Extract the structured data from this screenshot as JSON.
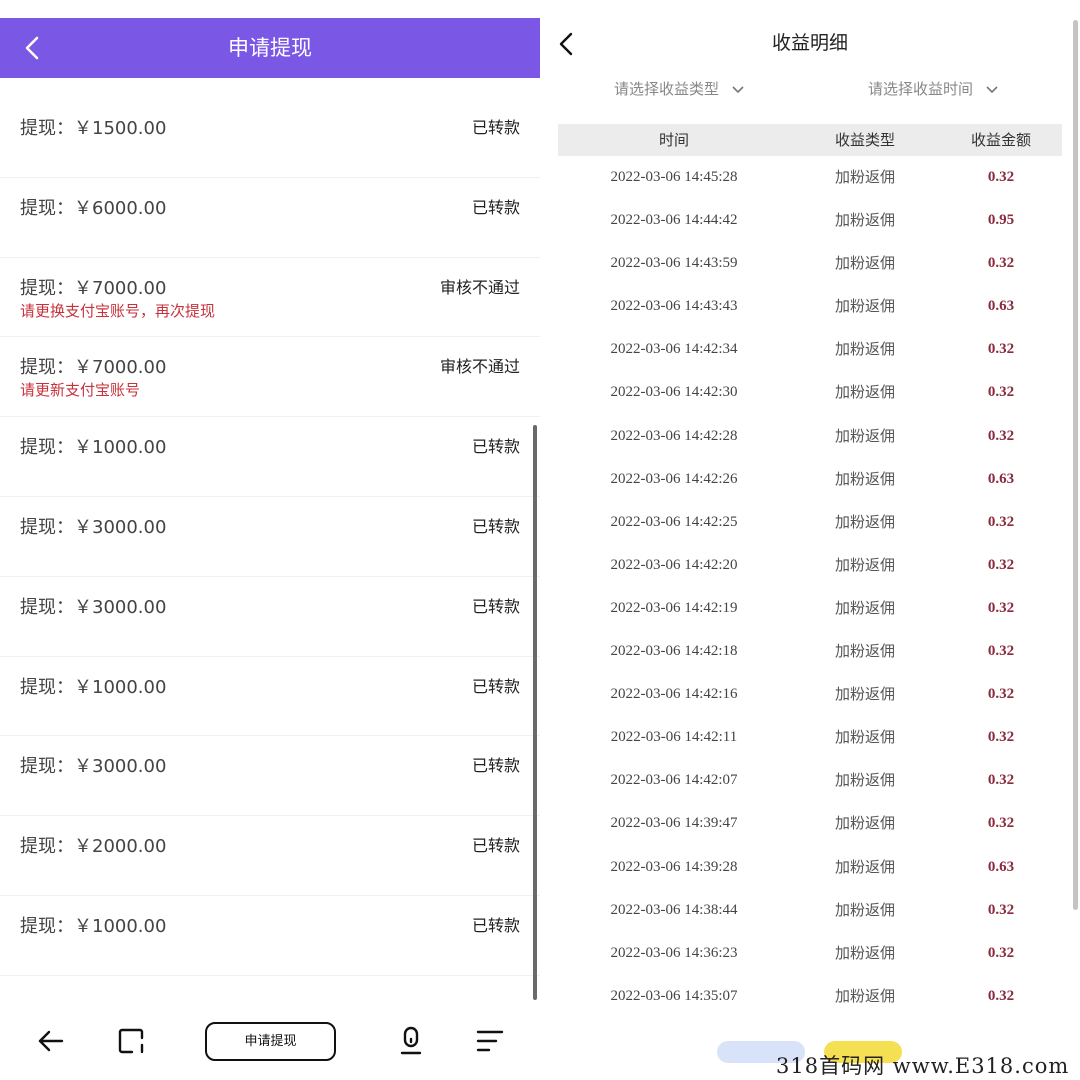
{
  "left": {
    "title": "申请提现",
    "items": [
      {
        "amount": "提现：￥1500.00",
        "status": "已转款",
        "note": ""
      },
      {
        "amount": "提现：￥6000.00",
        "status": "已转款",
        "note": ""
      },
      {
        "amount": "提现：￥7000.00",
        "status": "审核不通过",
        "note": "请更换支付宝账号，再次提现"
      },
      {
        "amount": "提现：￥7000.00",
        "status": "审核不通过",
        "note": "请更新支付宝账号"
      },
      {
        "amount": "提现：￥1000.00",
        "status": "已转款",
        "note": ""
      },
      {
        "amount": "提现：￥3000.00",
        "status": "已转款",
        "note": ""
      },
      {
        "amount": "提现：￥3000.00",
        "status": "已转款",
        "note": ""
      },
      {
        "amount": "提现：￥1000.00",
        "status": "已转款",
        "note": ""
      },
      {
        "amount": "提现：￥3000.00",
        "status": "已转款",
        "note": ""
      },
      {
        "amount": "提现：￥2000.00",
        "status": "已转款",
        "note": ""
      },
      {
        "amount": "提现：￥1000.00",
        "status": "已转款",
        "note": ""
      }
    ],
    "nav": {
      "back_icon": "arrow-left-icon",
      "recents_icon": "square-corner-icon",
      "button_label": "申请提现",
      "mic_icon": "microphone-icon",
      "menu_icon": "menu-lines-icon"
    }
  },
  "right": {
    "title": "收益明细",
    "filter_type": "请选择收益类型",
    "filter_time": "请选择收益时间",
    "columns": [
      "时间",
      "收益类型",
      "收益金额"
    ],
    "rows": [
      {
        "time": "2022-03-06 14:45:28",
        "type": "加粉返佣",
        "amount": "0.32"
      },
      {
        "time": "2022-03-06 14:44:42",
        "type": "加粉返佣",
        "amount": "0.95"
      },
      {
        "time": "2022-03-06 14:43:59",
        "type": "加粉返佣",
        "amount": "0.32"
      },
      {
        "time": "2022-03-06 14:43:43",
        "type": "加粉返佣",
        "amount": "0.63"
      },
      {
        "time": "2022-03-06 14:42:34",
        "type": "加粉返佣",
        "amount": "0.32"
      },
      {
        "time": "2022-03-06 14:42:30",
        "type": "加粉返佣",
        "amount": "0.32"
      },
      {
        "time": "2022-03-06 14:42:28",
        "type": "加粉返佣",
        "amount": "0.32"
      },
      {
        "time": "2022-03-06 14:42:26",
        "type": "加粉返佣",
        "amount": "0.63"
      },
      {
        "time": "2022-03-06 14:42:25",
        "type": "加粉返佣",
        "amount": "0.32"
      },
      {
        "time": "2022-03-06 14:42:20",
        "type": "加粉返佣",
        "amount": "0.32"
      },
      {
        "time": "2022-03-06 14:42:19",
        "type": "加粉返佣",
        "amount": "0.32"
      },
      {
        "time": "2022-03-06 14:42:18",
        "type": "加粉返佣",
        "amount": "0.32"
      },
      {
        "time": "2022-03-06 14:42:16",
        "type": "加粉返佣",
        "amount": "0.32"
      },
      {
        "time": "2022-03-06 14:42:11",
        "type": "加粉返佣",
        "amount": "0.32"
      },
      {
        "time": "2022-03-06 14:42:07",
        "type": "加粉返佣",
        "amount": "0.32"
      },
      {
        "time": "2022-03-06 14:39:47",
        "type": "加粉返佣",
        "amount": "0.32"
      },
      {
        "time": "2022-03-06 14:39:28",
        "type": "加粉返佣",
        "amount": "0.63"
      },
      {
        "time": "2022-03-06 14:38:44",
        "type": "加粉返佣",
        "amount": "0.32"
      },
      {
        "time": "2022-03-06 14:36:23",
        "type": "加粉返佣",
        "amount": "0.32"
      },
      {
        "time": "2022-03-06 14:35:07",
        "type": "加粉返佣",
        "amount": "0.32"
      }
    ]
  },
  "watermark": "318首码网 www.E318.com",
  "colors": {
    "header": "#7b57e6",
    "reject_note": "#c8323c",
    "amount": "#8a2a3c",
    "pill_blue": "#d8e2f8",
    "pill_yellow": "#f5df52"
  }
}
